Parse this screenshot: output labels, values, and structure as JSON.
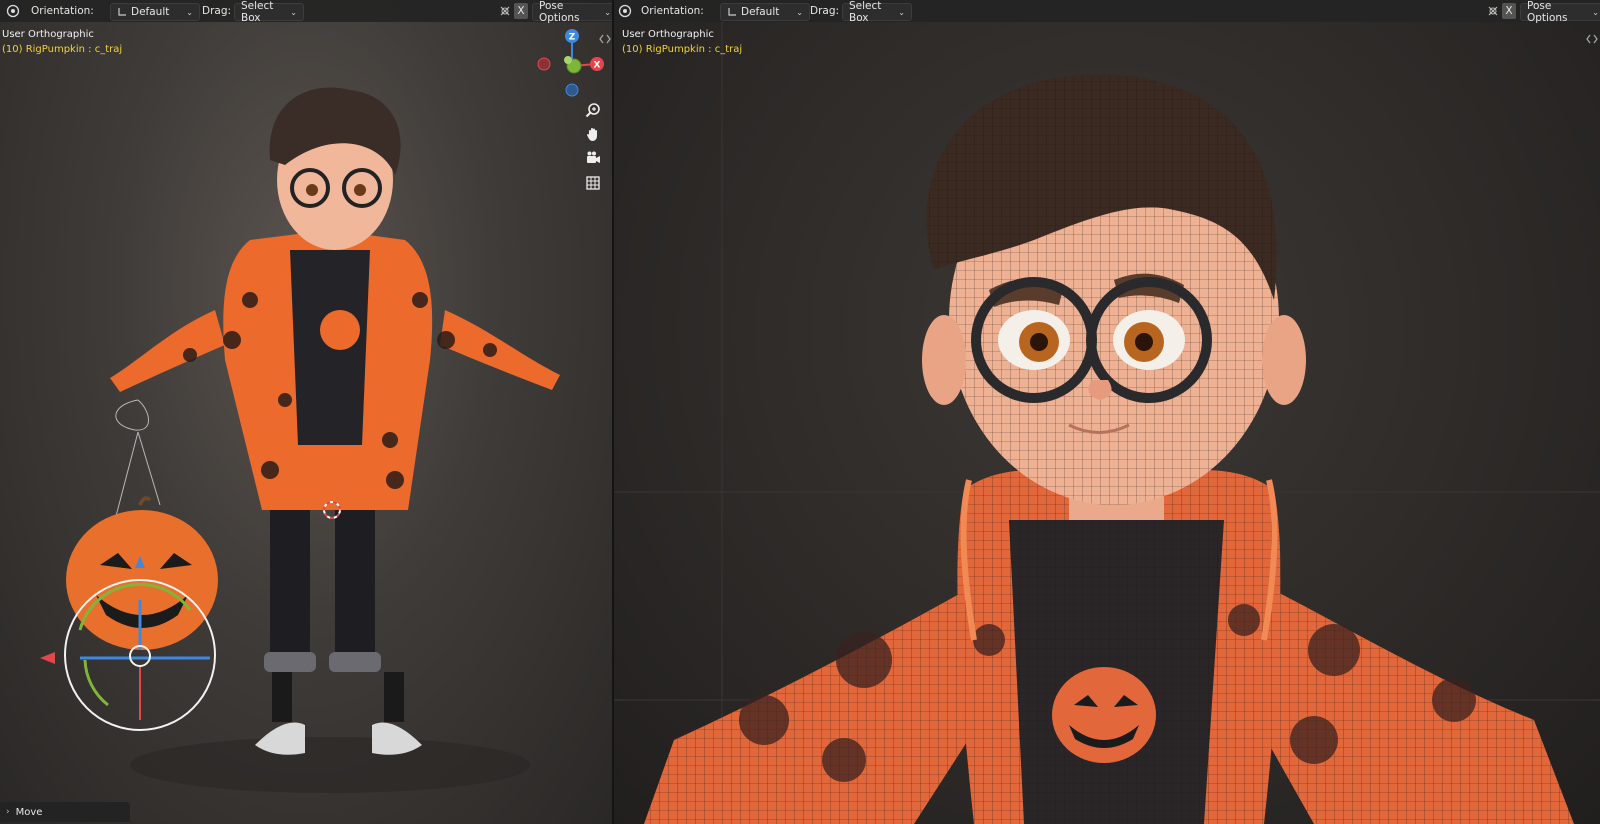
{
  "left_viewport": {
    "header": {
      "orientation_label": "Orientation:",
      "orientation_value": "Default",
      "drag_label": "Drag:",
      "drag_value": "Select Box",
      "x_button": "X",
      "pose_options": "Pose Options"
    },
    "view_name": "User Orthographic",
    "object_info": "(10) RigPumpkin : c_traj",
    "gizmo_axes": {
      "z": "Z",
      "x": "X"
    },
    "operator_panel": "Move"
  },
  "right_viewport": {
    "header": {
      "orientation_label": "Orientation:",
      "orientation_value": "Default",
      "drag_label": "Drag:",
      "drag_value": "Select Box",
      "x_button": "X",
      "pose_options": "Pose Options"
    },
    "view_name": "User Orthographic",
    "object_info": "(10) RigPumpkin : c_traj"
  },
  "colors": {
    "header_bg": "#242424",
    "object_text": "#f0d33b",
    "axis_x": "#e2474b",
    "axis_y": "#7fb539",
    "axis_z": "#3e88e0",
    "jacket": "#ec6a2c"
  }
}
